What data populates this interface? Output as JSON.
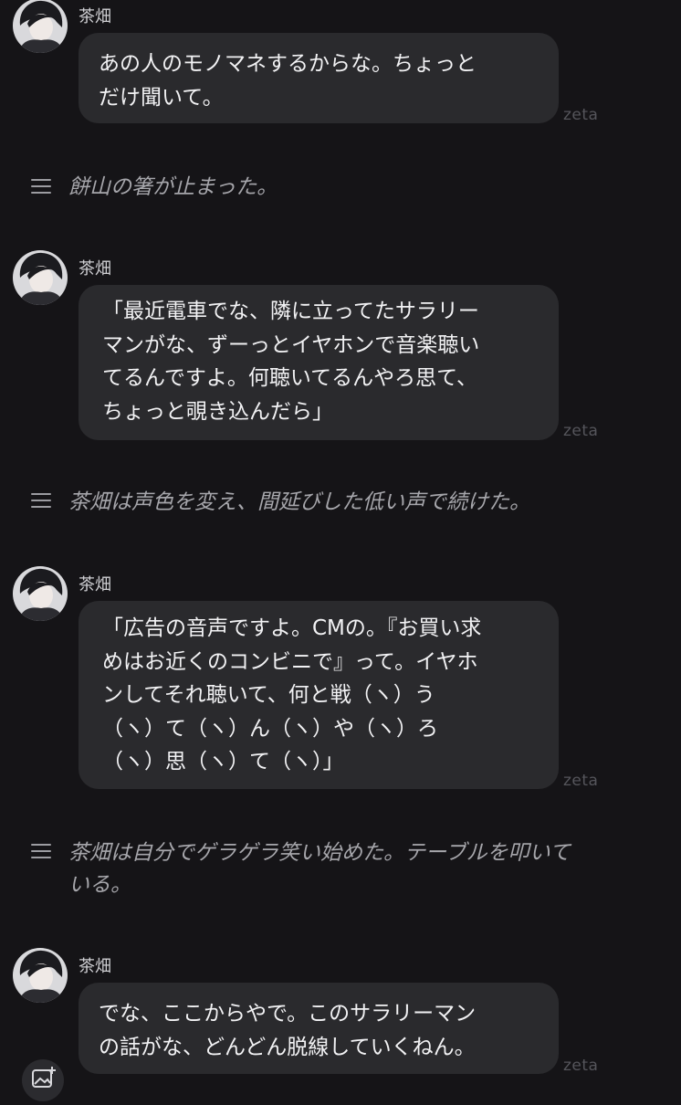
{
  "messages": [
    {
      "sender": "茶畑",
      "text": "あの人のモノマネするからな。ちょっと\nだけ聞いて。",
      "brand": "zeta"
    },
    {
      "sender": "茶畑",
      "text": "「最近電車でな、隣に立ってたサラリー\nマンがな、ずーっとイヤホンで音楽聴い\nてるんですよ。何聴いてるんやろ思て、\nちょっと覗き込んだら」",
      "brand": "zeta"
    },
    {
      "sender": "茶畑",
      "text": "「広告の音声ですよ。CMの。『お買い求\nめはお近くのコンビニで』って。イヤホ\nンしてそれ聴いて、何と戦（ヽ）う\n（ヽ）て（ヽ）ん（ヽ）や（ヽ）ろ\n（ヽ）思（ヽ）て（ヽ）」",
      "brand": "zeta"
    },
    {
      "sender": "茶畑",
      "text": "でな、ここからやで。このサラリーマン\nの話がな、どんどん脱線していくねん。",
      "brand": "zeta"
    }
  ],
  "narrations": [
    {
      "text": "餅山の箸が止まった。"
    },
    {
      "text": "茶畑は声色を変え、間延びした低い声で続けた。"
    },
    {
      "text": "茶畑は自分でゲラゲラ笑い始めた。テーブルを叩いて\nいる。"
    }
  ],
  "icons": {
    "avatar": "character-avatar",
    "narration": "lines-icon",
    "image_button": "add-image-icon"
  },
  "colors": {
    "background": "#151417",
    "bubble": "#2a2a2d",
    "narration_text": "#a6a6ab"
  }
}
